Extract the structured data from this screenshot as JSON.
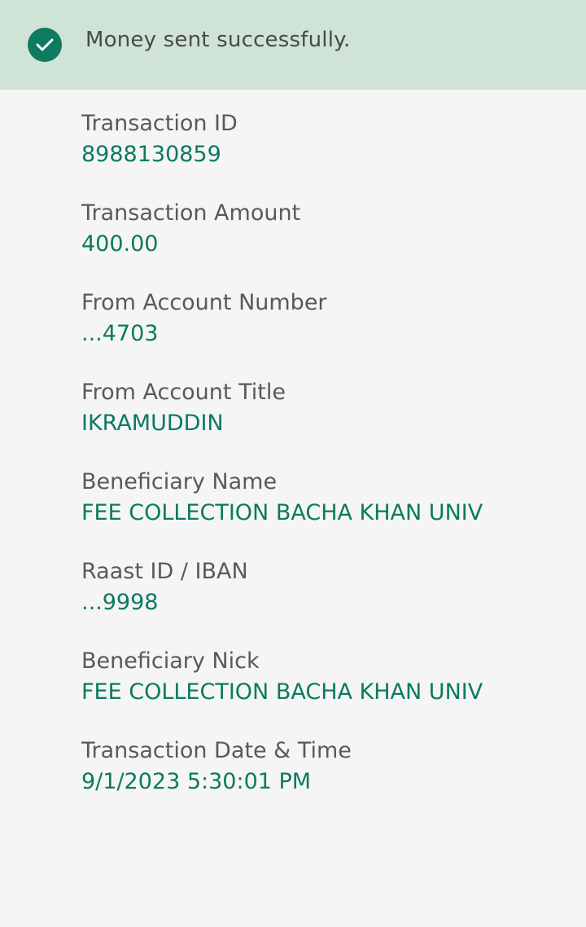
{
  "banner": {
    "message": "Money sent successfully.",
    "icon": "check-circle-icon",
    "accent_color": "#0e7a5f",
    "background_color": "#cfe3d6"
  },
  "details": {
    "fields": [
      {
        "label": "Transaction ID",
        "value": "8988130859"
      },
      {
        "label": "Transaction Amount",
        "value": "400.00"
      },
      {
        "label": "From Account Number",
        "value": "...4703"
      },
      {
        "label": "From Account Title",
        "value": "IKRAMUDDIN"
      },
      {
        "label": "Beneficiary Name",
        "value": "FEE COLLECTION BACHA KHAN UNIV"
      },
      {
        "label": "Raast ID / IBAN",
        "value": "...9998"
      },
      {
        "label": "Beneficiary Nick",
        "value": "FEE COLLECTION BACHA KHAN UNIV"
      },
      {
        "label": "Transaction Date & Time",
        "value": "9/1/2023 5:30:01 PM"
      }
    ]
  }
}
